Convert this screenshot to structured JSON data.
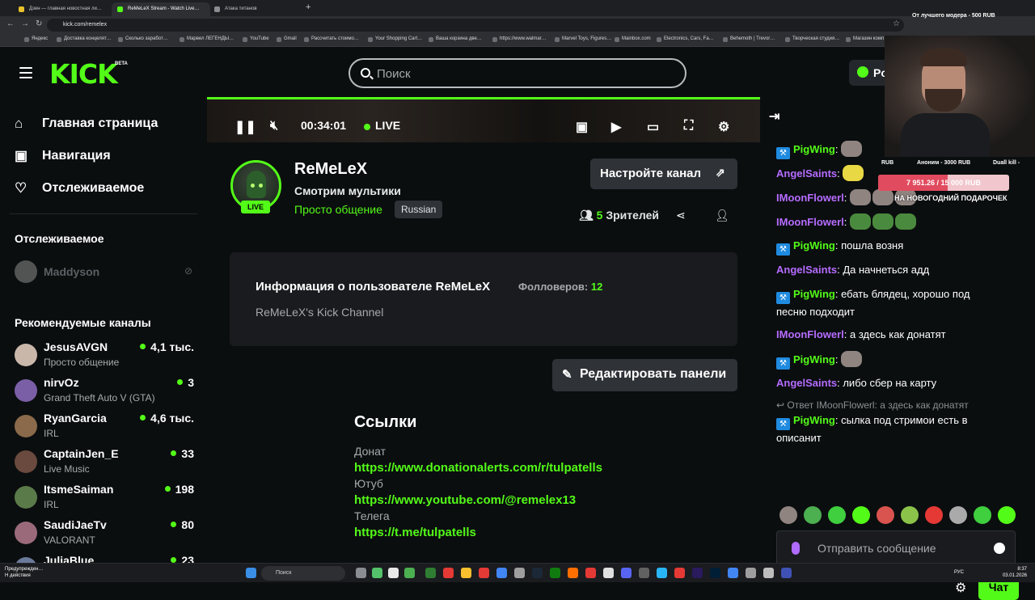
{
  "browser": {
    "tabs": [
      {
        "label": "Дзен — главная новостная ли…",
        "active": false
      },
      {
        "label": "ReMeLeX Stream - Watch Live…",
        "active": true
      },
      {
        "label": "Атака титанов",
        "active": false
      }
    ],
    "new_tab_label": "+",
    "url": "kick.com/remelex",
    "bookmarks": [
      "Яндекс",
      "Доставка концелят…",
      "Сколько заработ…",
      "Марвел ЛЕГЕНДЫ…",
      "YouTube",
      "Gmail",
      "Рассчитать стоимо…",
      "Your Shopping Cart…",
      "Ваша корзина две…",
      "https://www.walmar…",
      "Marvel Toys, Figures…",
      "Mainbox.com",
      "Electronics, Cars, Fa…",
      "Behemoth | Trevor…",
      "Творческая студия…",
      "Магазин комп…"
    ]
  },
  "header": {
    "logo_text": "KICK",
    "logo_beta": "BETA",
    "search_placeholder": "Поиск",
    "login_label": "Po"
  },
  "sidebar": {
    "nav": [
      {
        "label": "Главная страница",
        "icon": "home-icon"
      },
      {
        "label": "Навигация",
        "icon": "browse-icon"
      },
      {
        "label": "Отслеживаемое",
        "icon": "heart-icon"
      }
    ],
    "following_title": "Отслеживаемое",
    "following": [
      {
        "name": "Maddyson",
        "offline": true
      }
    ],
    "recommended_title": "Рекомендуемые каналы",
    "recommended": [
      {
        "name": "JesusAVGN",
        "category": "Просто общение",
        "viewers": "4,1 тыс.",
        "color": "#c9b8aa"
      },
      {
        "name": "nirvOz",
        "category": "Grand Theft Auto V (GTA)",
        "viewers": "3",
        "color": "#7a5fa6"
      },
      {
        "name": "RyanGarcia",
        "category": "IRL",
        "viewers": "4,6 тыс.",
        "color": "#8a6a4a"
      },
      {
        "name": "CaptainJen_E",
        "category": "Live Music",
        "viewers": "33",
        "color": "#6a4a3e"
      },
      {
        "name": "ItsmeSaiman",
        "category": "IRL",
        "viewers": "198",
        "color": "#5b7a4a"
      },
      {
        "name": "SaudiJaeTv",
        "category": "VALORANT",
        "viewers": "80",
        "color": "#9a6a7a"
      },
      {
        "name": "JuliaBlue",
        "category": "",
        "viewers": "23",
        "color": "#6a7a9a"
      }
    ]
  },
  "player": {
    "time": "00:34:01",
    "live_label": "LIVE"
  },
  "channel": {
    "name": "ReMeLeX",
    "live_badge": "LIVE",
    "stream_title": "Смотрим мультики",
    "category": "Просто общение",
    "language": "Russian",
    "setup_button": "Настройте канал",
    "viewers_count": "5",
    "viewers_label": "Зрителей"
  },
  "about": {
    "title": "Информация о пользователе ReMeLeX",
    "followers_label": "Фолловеров:",
    "followers_count": "12",
    "description": "ReMeLeX's Kick Channel"
  },
  "edit_panels_button": "Редактировать панели",
  "links": {
    "title": "Ссылки",
    "items": [
      {
        "label": "Донат",
        "url": "https://www.donationalerts.com/r/tulpatells"
      },
      {
        "label": "Ютуб",
        "url": "https://www.youtube.com/@remelex13"
      },
      {
        "label": "Телега",
        "url": "https://t.me/tulpatells"
      }
    ]
  },
  "chat": {
    "messages": [
      {
        "user": "PigWing",
        "color": "#53fc18",
        "badge": true,
        "text": ":",
        "emotes": 1
      },
      {
        "user": "AngelSaints",
        "color": "#b56cff",
        "badge": false,
        "text": ":",
        "emotes": 1
      },
      {
        "user": "IMoonFlowerl",
        "color": "#b56cff",
        "badge": false,
        "text": ":",
        "emotes": 3
      },
      {
        "user": "IMoonFlowerl",
        "color": "#b56cff",
        "badge": false,
        "text": ":",
        "emotes": 3
      },
      {
        "user": "PigWing",
        "color": "#53fc18",
        "badge": true,
        "text": ": пошла возня",
        "emotes": 0
      },
      {
        "user": "AngelSaints",
        "color": "#b56cff",
        "badge": false,
        "text": ": Да начнеться адд",
        "emotes": 0
      },
      {
        "user": "PigWing",
        "color": "#53fc18",
        "badge": true,
        "text": ": ебать блядец, хорошо под песню подходит",
        "emotes": 0
      },
      {
        "user": "IMoonFlowerl",
        "color": "#b56cff",
        "badge": false,
        "text": ": а здесь как донатят",
        "emotes": 0
      },
      {
        "user": "PigWing",
        "color": "#53fc18",
        "badge": true,
        "text": ":",
        "emotes": 1
      },
      {
        "user": "AngelSaints",
        "color": "#b56cff",
        "badge": false,
        "text": ": либо сбер на карту",
        "emotes": 0
      },
      {
        "user": "PigWing",
        "color": "#53fc18",
        "badge": true,
        "text": ": сылка под стримои есть в описанит",
        "emotes": 0
      }
    ],
    "reply_line": "Ответ IMoonFlowerl: а здесь как донатят",
    "input_placeholder": "Отправить сообщение",
    "send_button": "Чат"
  },
  "stream_overlay": {
    "top_donation": "От лучшего модера - 500 RUB",
    "stat_left": "RUB",
    "stat_mid": "Аноним - 3000 RUB",
    "stat_right": "Duall kill -",
    "goal_amount": "7 951.26 / 15 000 RUB",
    "goal_fraction": 0.53,
    "goal_label": "НА НОВОГОДНИЙ ПОДАРОЧЕК"
  },
  "taskbar": {
    "warning_line1": "Предупрежден…",
    "warning_line2": "Н действия",
    "search_label": "Поиск",
    "lang": "РУС",
    "time": "8:37",
    "date": "03.01.2026"
  }
}
